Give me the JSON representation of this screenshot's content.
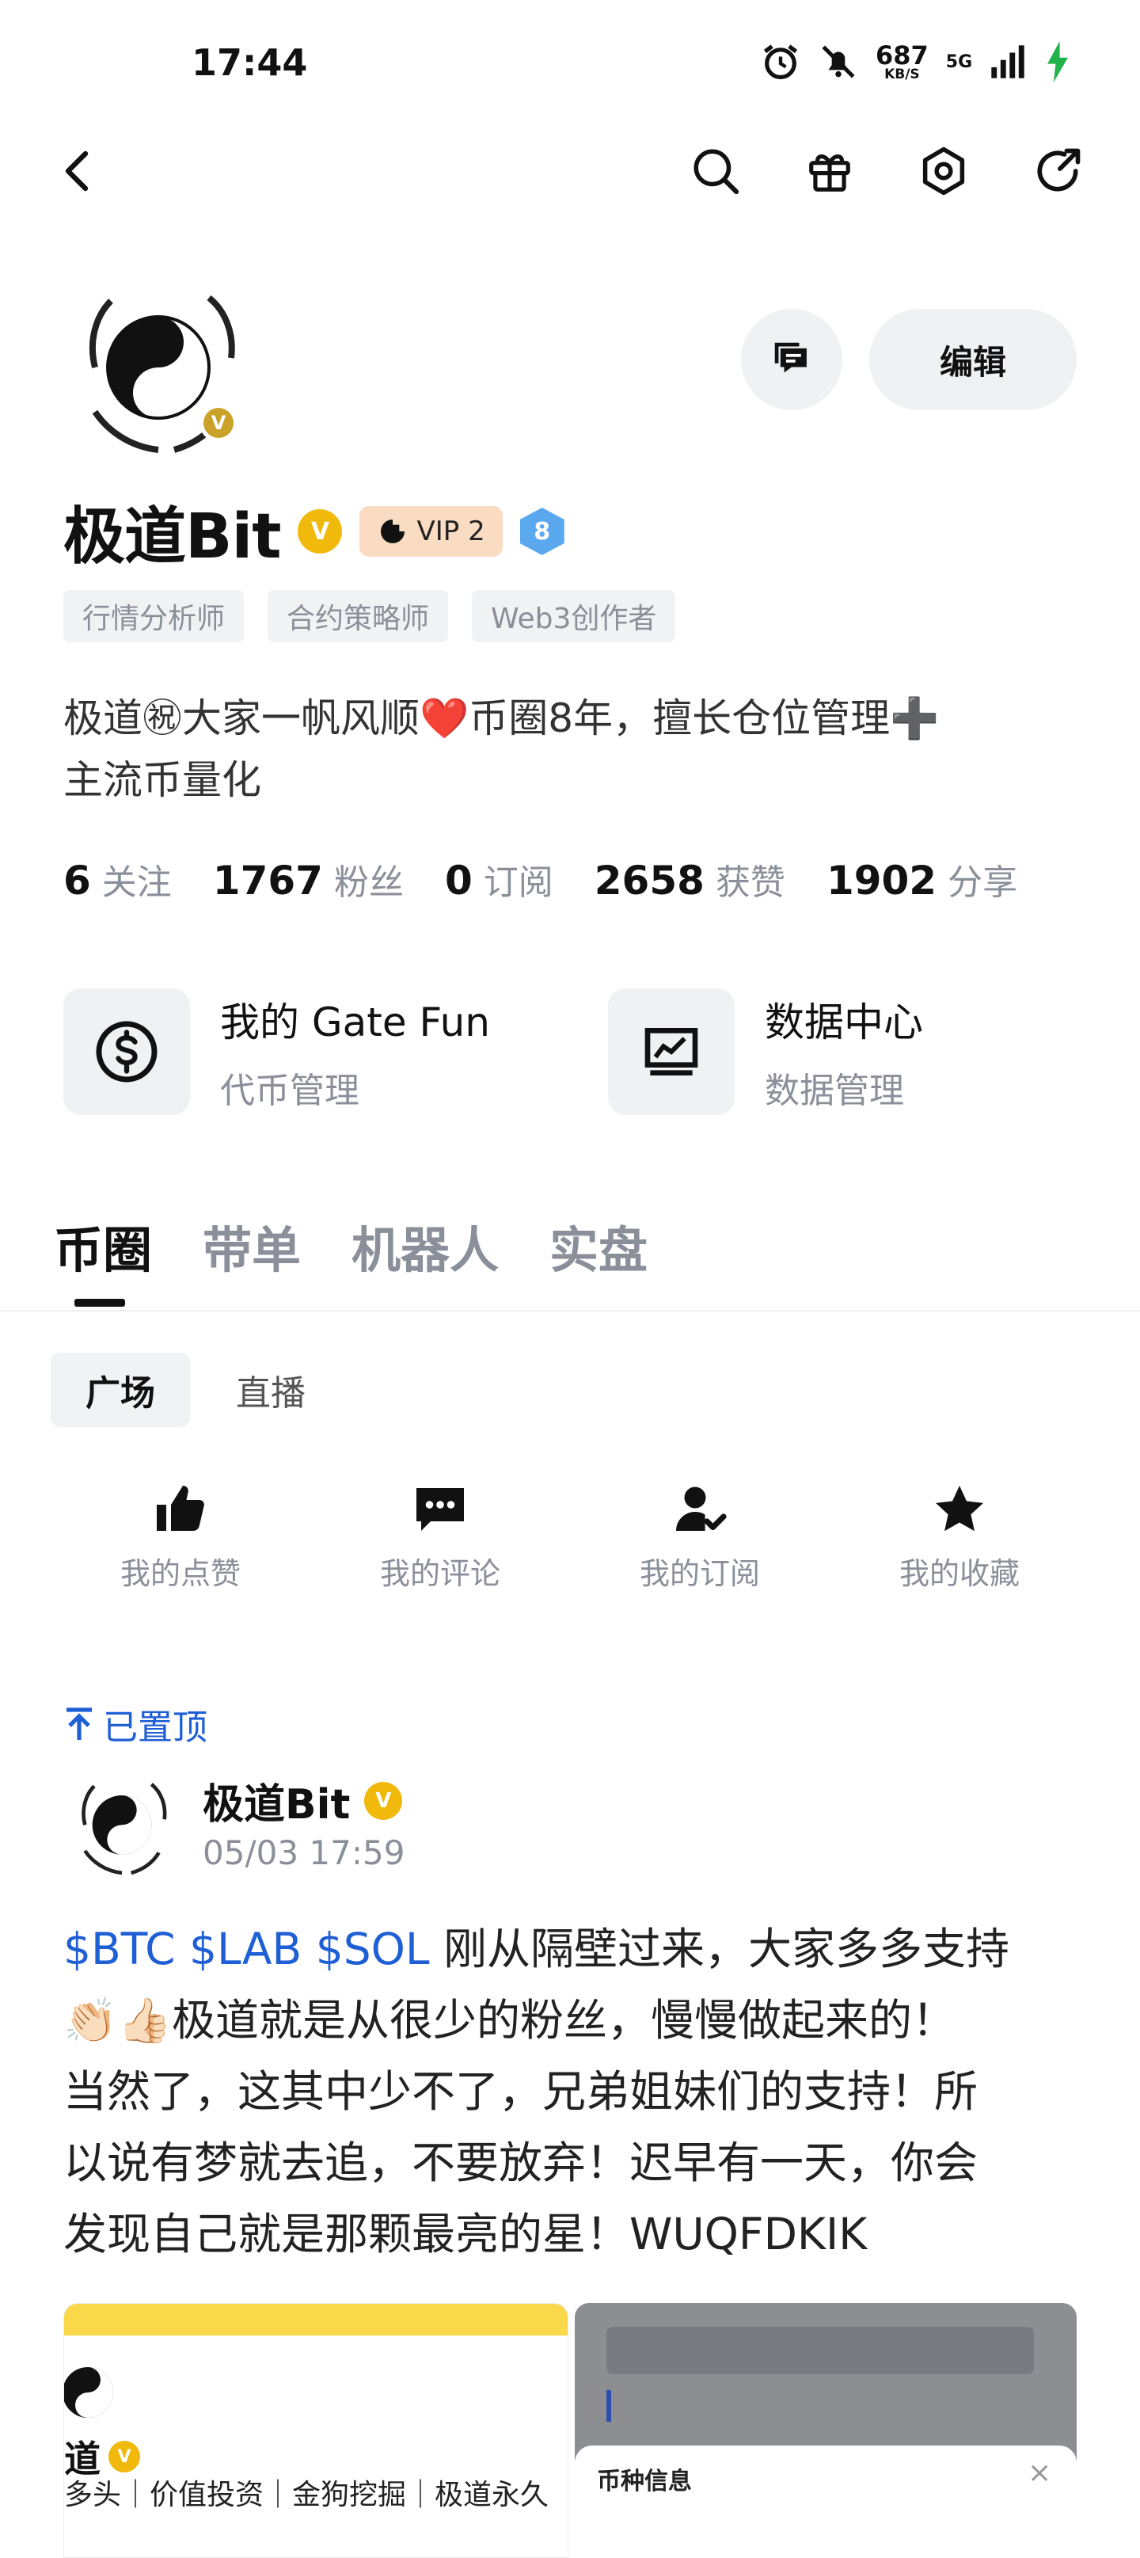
{
  "status_bar": {
    "time": "17:44",
    "net_speed": "687",
    "net_unit": "KB/S",
    "network": "5G"
  },
  "header": {
    "icons": [
      "back-arrow-icon",
      "search-icon",
      "gift-icon",
      "settings-icon",
      "share-icon"
    ]
  },
  "profile": {
    "avatar_badge": "V",
    "message_icon": "chat-icon",
    "edit_label": "编辑",
    "name": "极道Bit",
    "verified_badge": "V",
    "vip_label": "VIP 2",
    "level": "8",
    "tags": [
      "行情分析师",
      "合约策略师",
      "Web3创作者"
    ],
    "bio_line1": "极道㊗大家一帆风顺❤️币圈8年，擅长仓位管理➕",
    "bio_line2": "主流币量化",
    "stats": [
      {
        "value": "6",
        "label": "关注"
      },
      {
        "value": "1767",
        "label": "粉丝"
      },
      {
        "value": "0",
        "label": "订阅"
      },
      {
        "value": "2658",
        "label": "获赞"
      },
      {
        "value": "1902",
        "label": "分享"
      }
    ]
  },
  "tools": [
    {
      "title": "我的 Gate Fun",
      "subtitle": "代币管理",
      "icon": "dollar-circle-icon"
    },
    {
      "title": "数据中心",
      "subtitle": "数据管理",
      "icon": "chart-monitor-icon"
    }
  ],
  "main_tabs": [
    "币圈",
    "带单",
    "机器人",
    "实盘"
  ],
  "sub_tabs": [
    "广场",
    "直播"
  ],
  "quick_actions": [
    {
      "label": "我的点赞",
      "icon": "thumbs-up-icon"
    },
    {
      "label": "我的评论",
      "icon": "comment-icon"
    },
    {
      "label": "我的订阅",
      "icon": "user-check-icon"
    },
    {
      "label": "我的收藏",
      "icon": "star-icon"
    }
  ],
  "post": {
    "pinned_label": "已置顶",
    "author": "极道Bit",
    "time": "05/03 17:59",
    "tickers": "$BTC $LAB $SOL",
    "text_line1": " 刚从隔壁过来，大家多多支持",
    "text_line2": "👏🏻👍🏻极道就是从很少的粉丝，慢慢做起来的！",
    "text_line3": "当然了，这其中少不了，兄弟姐妹们的支持！所",
    "text_line4": "以说有梦就去追，不要放弃！迟早有一天，你会",
    "text_line5": "发现自己就是那颗最亮的星！WUQFDKIK",
    "image1_name": "道",
    "image1_caption": "多头｜价值投资｜金狗挖掘｜极道永久",
    "image2_title": "币种信息",
    "image2_close": "×"
  },
  "colors": {
    "accent_blue": "#1f5fd6",
    "gold": "#f0b90b",
    "vip_bg": "#f9dcc1",
    "level_blue": "#5aa8ee"
  }
}
